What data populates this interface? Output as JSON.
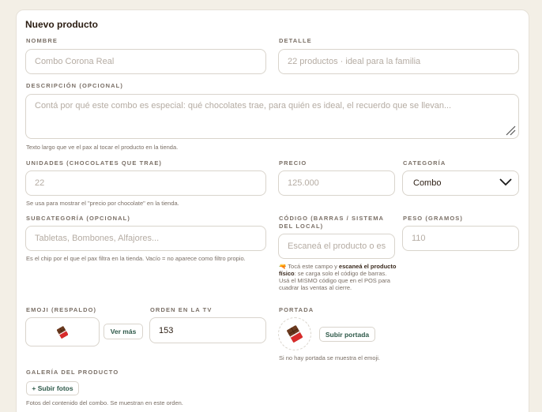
{
  "form": {
    "title": "Nuevo producto",
    "nombre": {
      "label": "NOMBRE",
      "placeholder": "Combo Corona Real"
    },
    "detalle": {
      "label": "DETALLE",
      "placeholder": "22 productos · ideal para la familia"
    },
    "descripcion": {
      "label": "DESCRIPCIÓN (OPCIONAL)",
      "placeholder": "Contá por qué este combo es especial: qué chocolates trae, para quién es ideal, el recuerdo que se llevan...",
      "hint": "Texto largo que ve el pax al tocar el producto en la tienda."
    },
    "unidades": {
      "label": "UNIDADES (CHOCOLATES QUE TRAE)",
      "placeholder": "22",
      "hint": "Se usa para mostrar el \"precio por chocolate\" en la tienda."
    },
    "precio": {
      "label": "PRECIO",
      "placeholder": "125.000"
    },
    "categoria": {
      "label": "CATEGORÍA",
      "value": "Combo"
    },
    "subcategoria": {
      "label": "SUBCATEGORÍA (OPCIONAL)",
      "placeholder": "Tabletas, Bombones, Alfajores...",
      "hint": "Es el chip por el que el pax filtra en la tienda. Vacío = no aparece como filtro propio."
    },
    "codigo": {
      "label": "CÓDIGO (BARRAS / SISTEMA DEL LOCAL)",
      "placeholder": "Escaneá el producto o es",
      "hint_icon": "🔫",
      "hint_pre": " Tocá este campo y ",
      "hint_bold": "escaneá el producto físico",
      "hint_post": ": se carga solo el código de barras. Usá el MISMO código que en el POS para cuadrar las ventas al cierre."
    },
    "peso": {
      "label": "PESO (GRAMOS)",
      "placeholder": "110"
    },
    "emoji": {
      "label": "EMOJI (RESPALDO)",
      "value": "🍫",
      "more_label": "Ver más"
    },
    "orden": {
      "label": "ORDEN EN LA TV",
      "value": "153"
    },
    "portada": {
      "label": "PORTADA",
      "upload_label": "Subir portada",
      "hint": "Si no hay portada se muestra el emoji."
    },
    "galeria": {
      "label": "GALERÍA DEL PRODUCTO",
      "add_label": "+ Subir fotos",
      "hint": "Fotos del contenido del combo. Se muestran en este orden."
    }
  },
  "colors": {
    "accent": "#2f5a4a",
    "border": "#d9d4cc",
    "background": "#f3efe6"
  },
  "icons": {
    "chocolate": "chocolate-icon",
    "select": "chevron-down-icon",
    "resize": "resize-grip-icon"
  }
}
